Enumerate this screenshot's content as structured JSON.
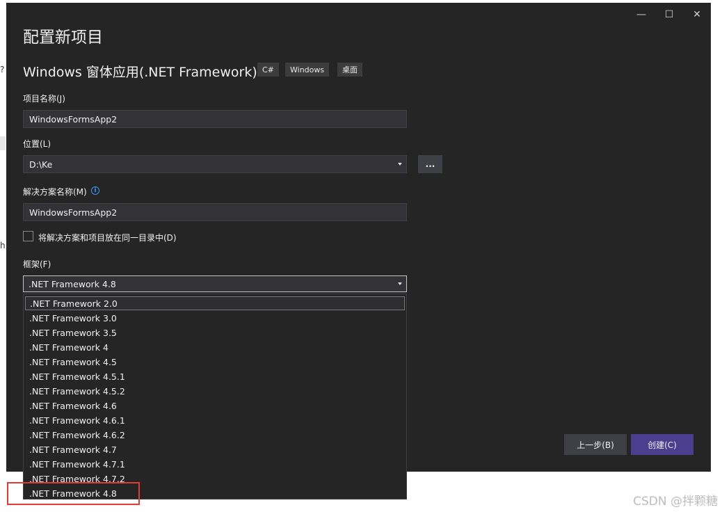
{
  "background_fragments": [
    "?",
    "h,"
  ],
  "window": {
    "title": "配置新项目",
    "controls": {
      "minimize": "—",
      "maximize": "☐",
      "close": "✕"
    },
    "template": {
      "name": "Windows 窗体应用(.NET Framework)",
      "tags": [
        "C#",
        "Windows",
        "桌面"
      ]
    },
    "project_name": {
      "label": "项目名称(J)",
      "value": "WindowsFormsApp2"
    },
    "location": {
      "label": "位置(L)",
      "value": "D:\\Ke",
      "browse": "..."
    },
    "solution_name": {
      "label": "解决方案名称(M)",
      "info": "i",
      "value": "WindowsFormsApp2"
    },
    "same_dir": {
      "label": "将解决方案和项目放在同一目录中(D)",
      "checked": false
    },
    "framework": {
      "label": "框架(F)",
      "selected": ".NET Framework 4.8",
      "options": [
        ".NET Framework 2.0",
        ".NET Framework 3.0",
        ".NET Framework 3.5",
        ".NET Framework 4",
        ".NET Framework 4.5",
        ".NET Framework 4.5.1",
        ".NET Framework 4.5.2",
        ".NET Framework 4.6",
        ".NET Framework 4.6.1",
        ".NET Framework 4.6.2",
        ".NET Framework 4.7",
        ".NET Framework 4.7.1",
        ".NET Framework 4.7.2",
        ".NET Framework 4.8"
      ]
    },
    "buttons": {
      "back": "上一步(B)",
      "create": "创建(C)"
    }
  },
  "watermark": "CSDN @拌颗糖",
  "colors": {
    "window_bg": "#252526",
    "input_bg": "#333337",
    "back_button": "#3f3f46",
    "create_button": "#4b3e8f",
    "highlight_border": "#e53935",
    "info_icon": "#3794ff"
  }
}
